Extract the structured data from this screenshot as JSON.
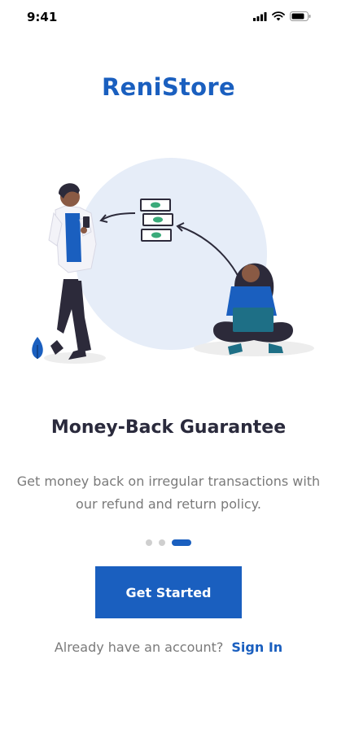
{
  "status_bar": {
    "time": "9:41",
    "icons": [
      "cellular-signal-icon",
      "wifi-icon",
      "battery-icon"
    ]
  },
  "brand": {
    "name": "ReniStore",
    "color": "#1a5fbf"
  },
  "onboarding": {
    "title": "Money-Back Guarantee",
    "description": "Get money back on irregular transactions with our refund and return policy.",
    "pager": {
      "total": 3,
      "active_index": 2
    }
  },
  "actions": {
    "primary_label": "Get Started",
    "signin_prompt": "Already have an account?",
    "signin_label": "Sign In"
  },
  "colors": {
    "accent": "#1a5fbf",
    "illustration_bg": "#e6edf8",
    "person_shirt": "#1a5fbf"
  }
}
